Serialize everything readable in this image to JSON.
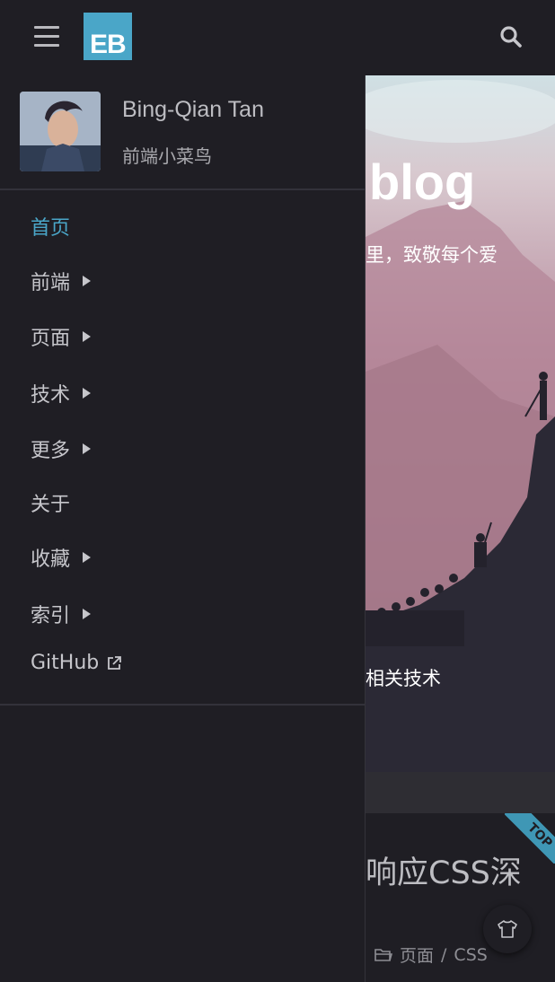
{
  "header": {
    "logo_text": "EB",
    "menu_icon": "hamburger-icon",
    "search_icon": "search-icon"
  },
  "drawer": {
    "profile": {
      "name": "Bing-Qian Tan",
      "tagline": "前端小菜鸟"
    },
    "menu": [
      {
        "label": "首页",
        "active": true,
        "submenu": false
      },
      {
        "label": "前端",
        "active": false,
        "submenu": true
      },
      {
        "label": "页面",
        "active": false,
        "submenu": true
      },
      {
        "label": "技术",
        "active": false,
        "submenu": true
      },
      {
        "label": "更多",
        "active": false,
        "submenu": true
      },
      {
        "label": "关于",
        "active": false,
        "submenu": false
      },
      {
        "label": "收藏",
        "active": false,
        "submenu": true
      },
      {
        "label": "索引",
        "active": false,
        "submenu": true
      },
      {
        "label": "GitHub",
        "active": false,
        "submenu": false,
        "external": true
      }
    ]
  },
  "background_page": {
    "hero_title_partial": "blog",
    "hero_subtitle_partial": "里，致敬每个爱",
    "hero_line2_partial": "相关技术",
    "post_title_partial": "响应CSS深",
    "top_badge": "TOP",
    "meta_category": "页面",
    "meta_separator": "/",
    "meta_tag": "CSS"
  },
  "colors": {
    "background": "#1f1e24",
    "accent": "#4aa6c8",
    "text": "#c6c6cb"
  }
}
